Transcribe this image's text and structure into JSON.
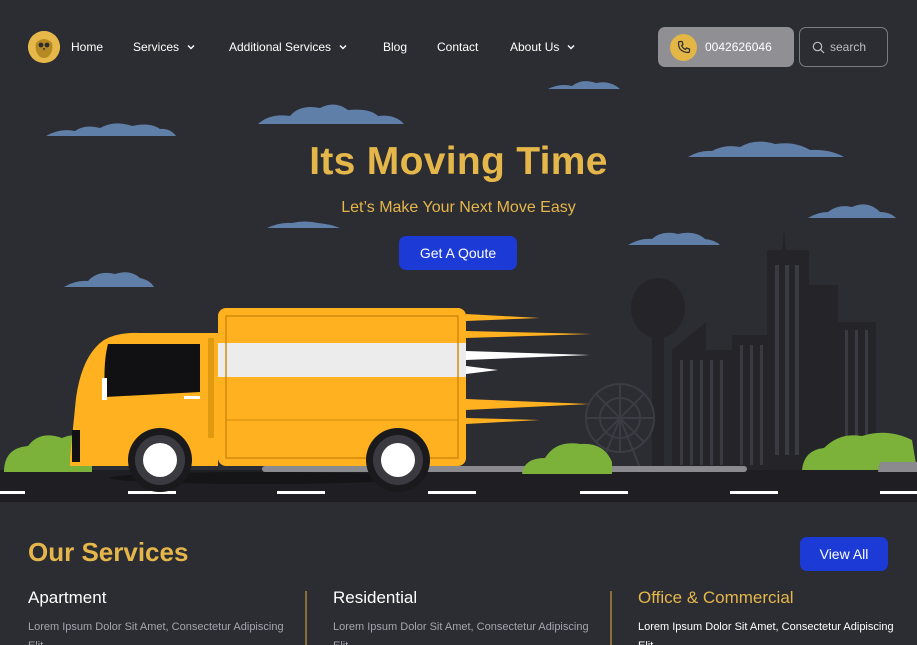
{
  "nav": {
    "links": [
      {
        "label": "Home"
      },
      {
        "label": "Services"
      },
      {
        "label": "Additional Services"
      },
      {
        "label": "Blog"
      },
      {
        "label": "Contact"
      },
      {
        "label": "About Us"
      }
    ],
    "phone": "0042626046",
    "search_placeholder": "search"
  },
  "hero": {
    "title": "Its Moving Time",
    "subtitle": "Let’s Make Your Next Move Easy",
    "cta_label": "Get A Qoute"
  },
  "services": {
    "title": "Our Services",
    "view_all_label": "View All",
    "items": [
      {
        "title": "Apartment",
        "desc": "Lorem Ipsum Dolor Sit Amet, Consectetur Adipiscing Elit"
      },
      {
        "title": "Residential",
        "desc": "Lorem Ipsum Dolor Sit Amet, Consectetur Adipiscing Elit"
      },
      {
        "title": "Office & Commercial",
        "desc": "Lorem Ipsum Dolor Sit Amet, Consectetur Adipiscing Elit"
      }
    ]
  },
  "colors": {
    "background": "#2c2c33",
    "accent_gold": "#e5b74a",
    "primary_blue": "#1c3ad6",
    "truck_orange": "#ffb11f",
    "bush_green": "#7cb23a",
    "cloud_blue": "#5f7fa8"
  },
  "icons": {
    "logo": "owl-logo-icon",
    "phone": "phone-icon",
    "search": "search-icon",
    "dropdown": "chevron-down-icon"
  }
}
